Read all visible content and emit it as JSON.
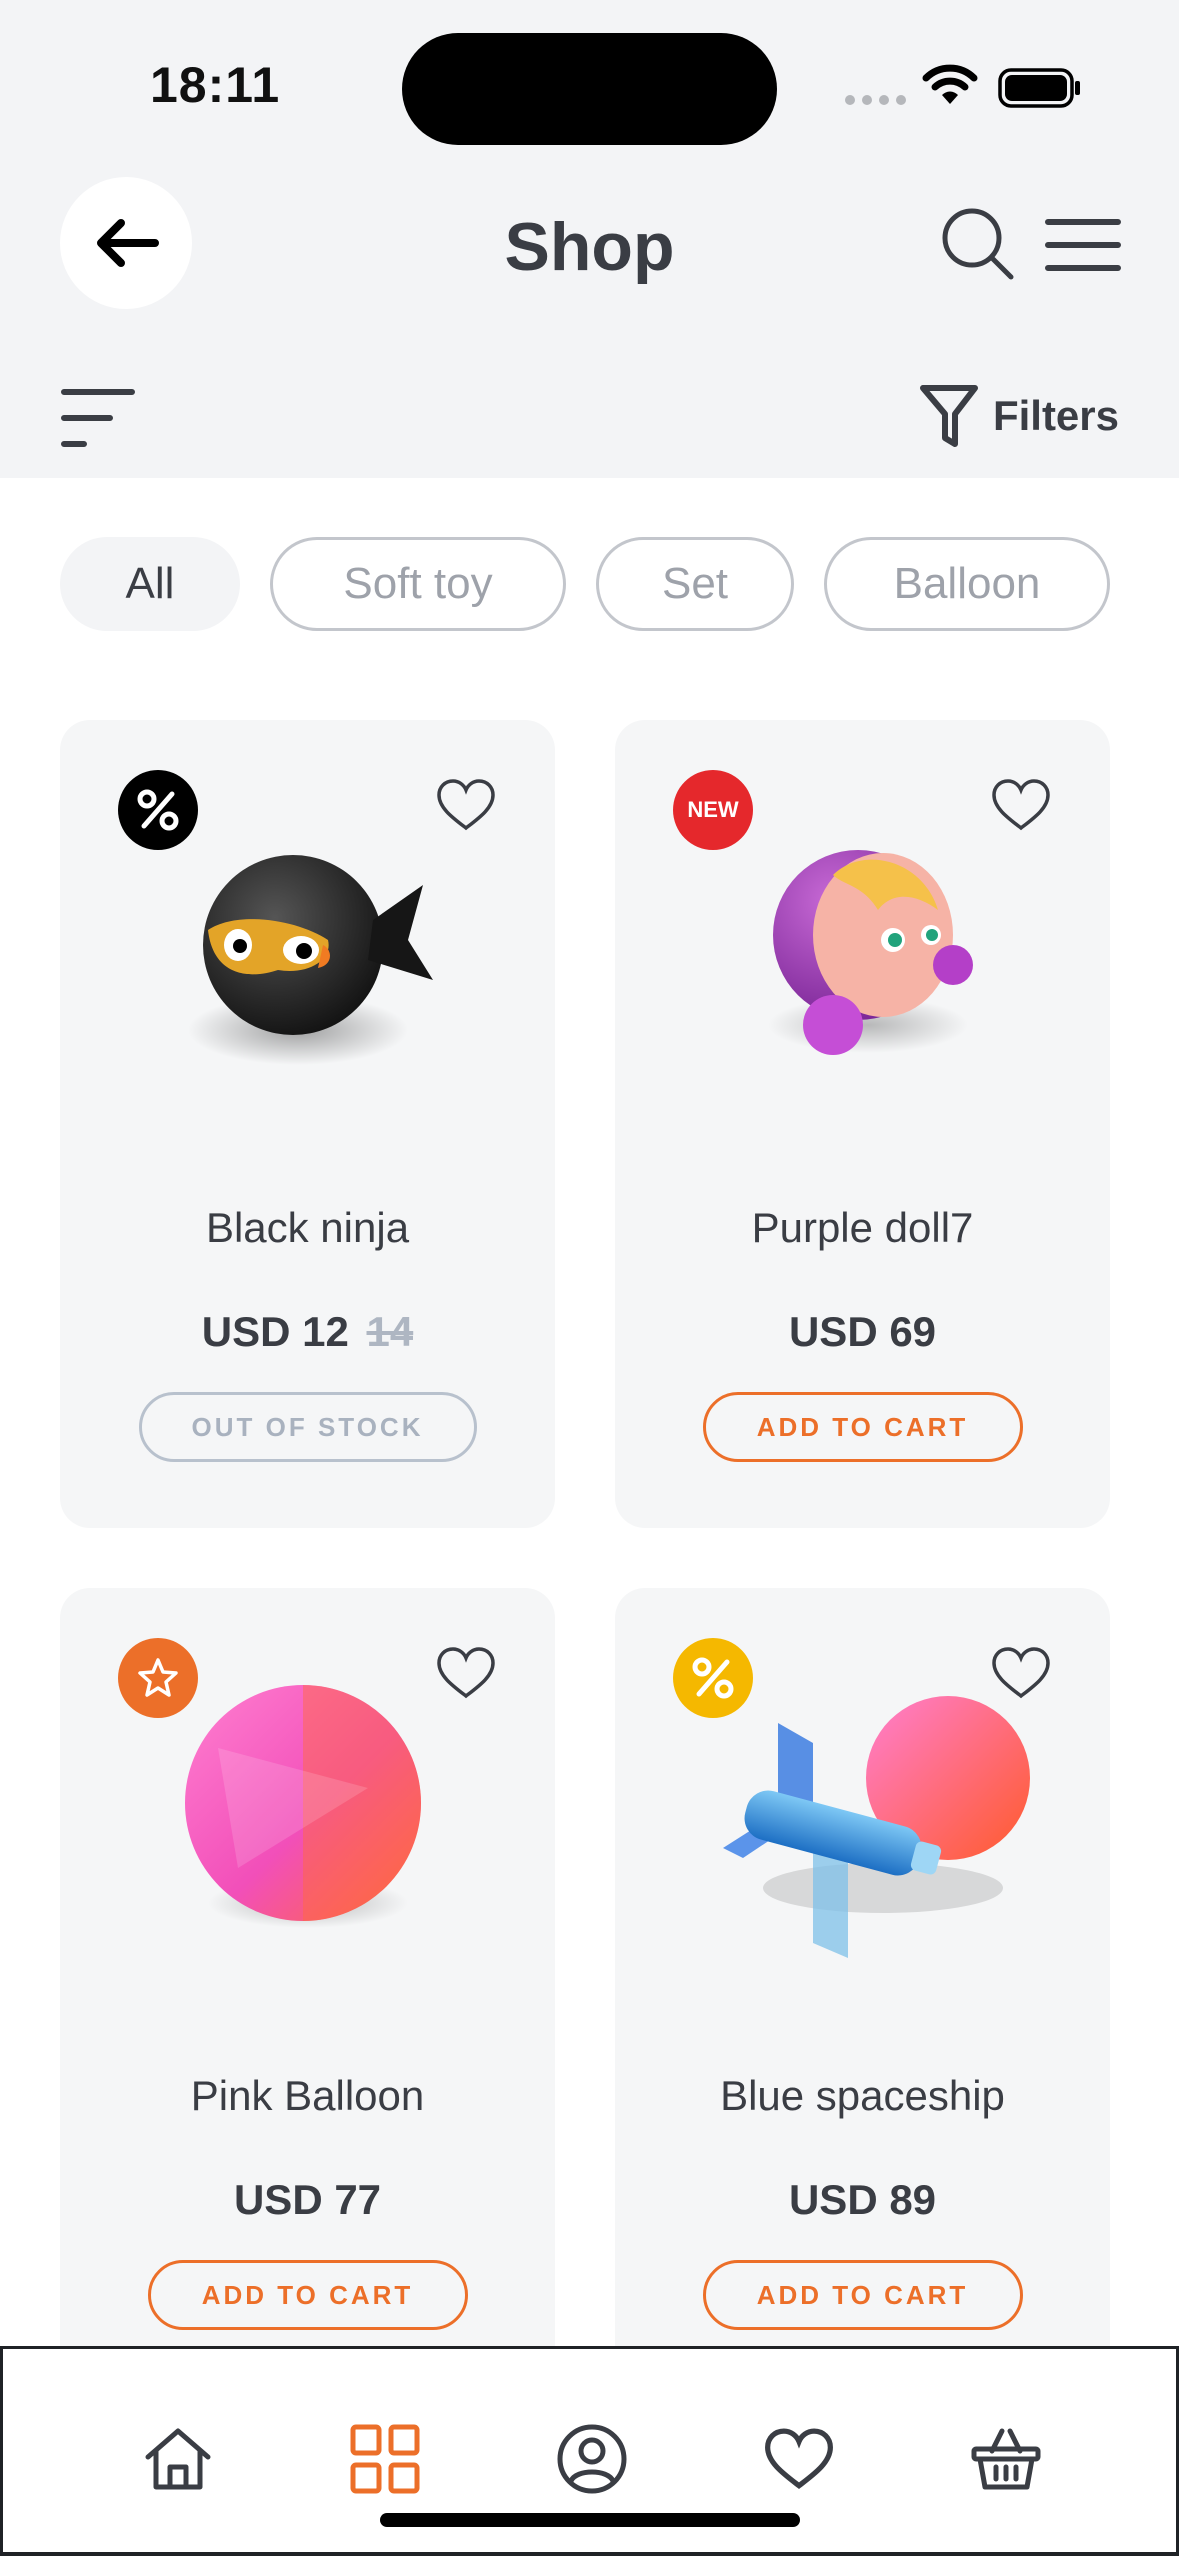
{
  "status_bar": {
    "time": "18:11"
  },
  "header": {
    "title": "Shop",
    "filters_label": "Filters"
  },
  "categories": [
    {
      "label": "All",
      "active": true
    },
    {
      "label": "Soft toy",
      "active": false
    },
    {
      "label": "Set",
      "active": false
    },
    {
      "label": "Balloon",
      "active": false
    }
  ],
  "products": [
    {
      "name": "Black ninja",
      "price": "USD 12",
      "old_price": "14",
      "badge": "%",
      "badge_color": "#000000",
      "cta": "OUT OF STOCK",
      "in_stock": false
    },
    {
      "name": "Purple doll7",
      "price": "USD 69",
      "old_price": "",
      "badge": "NEW",
      "badge_color": "#e5282c",
      "cta": "ADD TO CART",
      "in_stock": true
    },
    {
      "name": "Pink Balloon",
      "price": "USD 77",
      "old_price": "",
      "badge": "star",
      "badge_color": "#ec6f29",
      "cta": "ADD TO CART",
      "in_stock": true
    },
    {
      "name": "Blue spaceship",
      "price": "USD 89",
      "old_price": "",
      "badge": "%",
      "badge_color": "#f5b800",
      "cta": "ADD TO CART",
      "in_stock": true
    }
  ],
  "bottom_nav": {
    "items": [
      "home-icon",
      "grid-icon",
      "profile-icon",
      "heart-icon",
      "basket-icon"
    ],
    "active": "grid-icon"
  },
  "colors": {
    "accent": "#ec6f29",
    "background": "#f3f4f6",
    "text": "#3a3d44"
  }
}
